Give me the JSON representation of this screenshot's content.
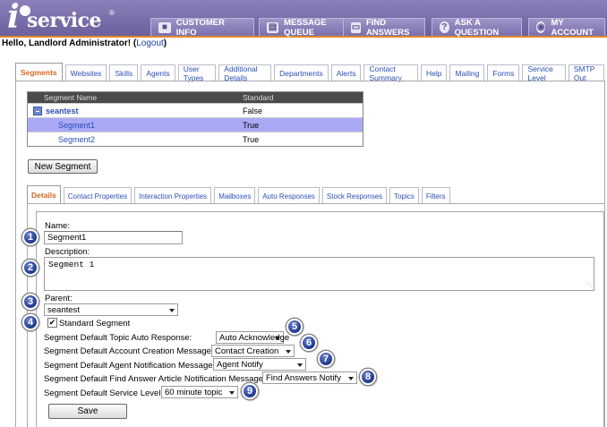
{
  "app": {
    "logo_letter": "i",
    "logo_word": "service",
    "logo_mark": "®"
  },
  "nav": [
    {
      "label": "CUSTOMER INFO",
      "icon": "customer-info-icon"
    },
    {
      "label": "MESSAGE QUEUE",
      "icon": "message-queue-icon"
    },
    {
      "label": "FIND ANSWERS",
      "icon": "book-icon"
    },
    {
      "label": "ASK A QUESTION",
      "icon": "question-icon"
    },
    {
      "label": "MY ACCOUNT",
      "icon": "account-icon"
    }
  ],
  "greeting": {
    "text": "Hello, Landlord Administrator!",
    "open_paren": "(",
    "logout": "Logout",
    "close_paren": ")"
  },
  "main_tabs": [
    "Segments",
    "Websites",
    "Skills",
    "Agents",
    "User Types",
    "Additional Details",
    "Departments",
    "Alerts",
    "Contact Summary",
    "Help",
    "Mailing",
    "Forms",
    "Service Level",
    "SMTP Out"
  ],
  "segments_table": {
    "headers": [
      "Segment Name",
      "Standard"
    ],
    "rows": [
      {
        "name": "seantest",
        "standard": "False"
      },
      {
        "name": "Segment1",
        "standard": "True"
      },
      {
        "name": "Segment2",
        "standard": "True"
      }
    ]
  },
  "new_segment_button": "New Segment",
  "detail_tabs": [
    "Details",
    "Contact Properties",
    "Interaction Properties",
    "Mailboxes",
    "Auto Responses",
    "Stock Responses",
    "Topics",
    "Filters"
  ],
  "form": {
    "name_label": "Name:",
    "name_value": "Segment1",
    "description_label": "Description:",
    "description_value": "Segment 1",
    "parent_label": "Parent:",
    "parent_value": "seantest",
    "standard_label": "Standard Segment",
    "standard_checked": true,
    "topic_auto_response_label": "Segment Default Topic Auto Response:",
    "topic_auto_response_value": "Auto Acknowledge",
    "account_creation_label": "Segment Default Account Creation Message:",
    "account_creation_value": "Contact Creation",
    "agent_notification_label": "Segment Default Agent Notification Message:",
    "agent_notification_value": "Agent Notify",
    "find_answer_label": "Segment Default Find Answer Article Notification Message:",
    "find_answer_value": "Find Answers Notify",
    "service_level_label": "Segment Default Service Level:",
    "service_level_value": "60 minute topic",
    "save_button": "Save"
  },
  "badges": [
    "1",
    "2",
    "3",
    "4",
    "5",
    "6",
    "7",
    "8",
    "9"
  ],
  "colors": {
    "header": "#7d72ad",
    "header_accent": "#e08a2a",
    "active_tab": "#d6671e",
    "link": "#2a4fb5",
    "selected_row": "#a9a9f6",
    "badge": "#1e3a8f"
  }
}
